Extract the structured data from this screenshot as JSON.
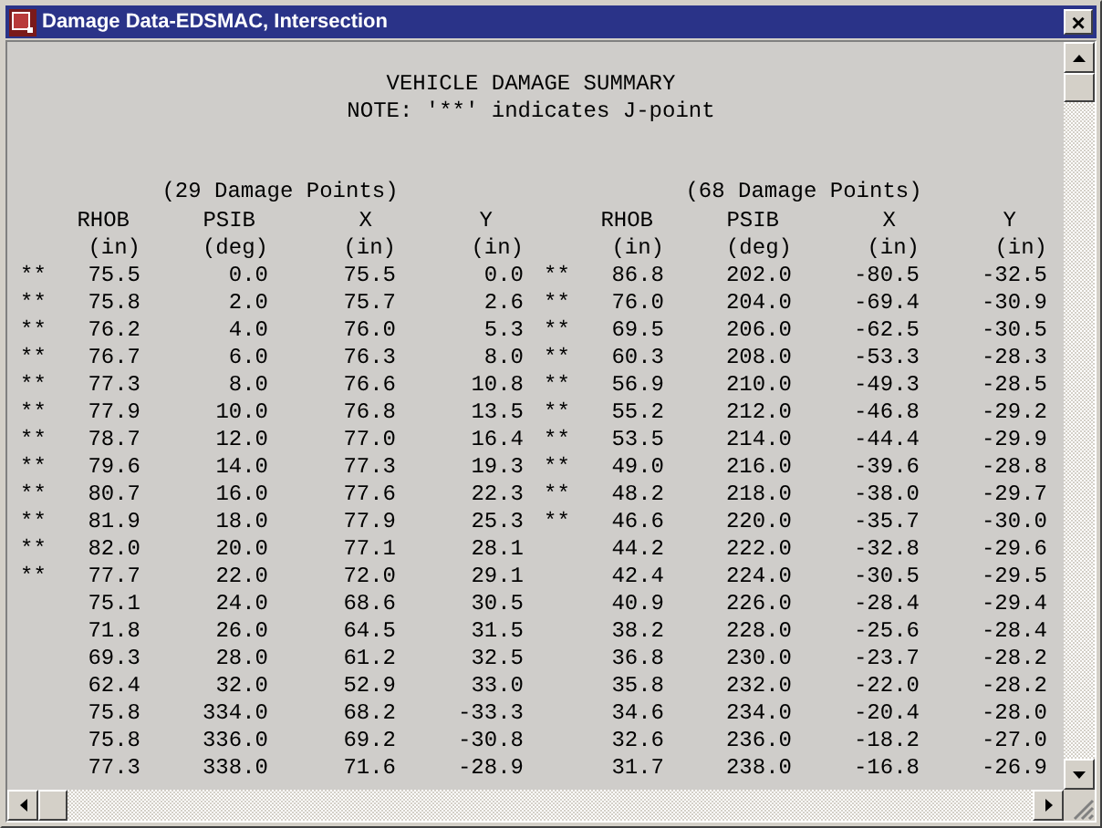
{
  "window": {
    "title": "Damage Data-EDSMAC, Intersection",
    "close_label": "×"
  },
  "heading": "VEHICLE DAMAGE SUMMARY",
  "note": "NOTE: '**' indicates J-point",
  "groups": [
    {
      "title": "(29 Damage Points)",
      "marker": "**",
      "columns": [
        {
          "name": "RHOB",
          "unit": "(in)"
        },
        {
          "name": "PSIB",
          "unit": "(deg)"
        },
        {
          "name": "X",
          "unit": "(in)"
        },
        {
          "name": "Y",
          "unit": "(in)"
        }
      ],
      "rows": [
        {
          "jpoint": true,
          "values": [
            "75.5",
            "0.0",
            "75.5",
            "0.0"
          ]
        },
        {
          "jpoint": true,
          "values": [
            "75.8",
            "2.0",
            "75.7",
            "2.6"
          ]
        },
        {
          "jpoint": true,
          "values": [
            "76.2",
            "4.0",
            "76.0",
            "5.3"
          ]
        },
        {
          "jpoint": true,
          "values": [
            "76.7",
            "6.0",
            "76.3",
            "8.0"
          ]
        },
        {
          "jpoint": true,
          "values": [
            "77.3",
            "8.0",
            "76.6",
            "10.8"
          ]
        },
        {
          "jpoint": true,
          "values": [
            "77.9",
            "10.0",
            "76.8",
            "13.5"
          ]
        },
        {
          "jpoint": true,
          "values": [
            "78.7",
            "12.0",
            "77.0",
            "16.4"
          ]
        },
        {
          "jpoint": true,
          "values": [
            "79.6",
            "14.0",
            "77.3",
            "19.3"
          ]
        },
        {
          "jpoint": true,
          "values": [
            "80.7",
            "16.0",
            "77.6",
            "22.3"
          ]
        },
        {
          "jpoint": true,
          "values": [
            "81.9",
            "18.0",
            "77.9",
            "25.3"
          ]
        },
        {
          "jpoint": true,
          "values": [
            "82.0",
            "20.0",
            "77.1",
            "28.1"
          ]
        },
        {
          "jpoint": true,
          "values": [
            "77.7",
            "22.0",
            "72.0",
            "29.1"
          ]
        },
        {
          "jpoint": false,
          "values": [
            "75.1",
            "24.0",
            "68.6",
            "30.5"
          ]
        },
        {
          "jpoint": false,
          "values": [
            "71.8",
            "26.0",
            "64.5",
            "31.5"
          ]
        },
        {
          "jpoint": false,
          "values": [
            "69.3",
            "28.0",
            "61.2",
            "32.5"
          ]
        },
        {
          "jpoint": false,
          "values": [
            "62.4",
            "32.0",
            "52.9",
            "33.0"
          ]
        },
        {
          "jpoint": false,
          "values": [
            "75.8",
            "334.0",
            "68.2",
            "-33.3"
          ]
        },
        {
          "jpoint": false,
          "values": [
            "75.8",
            "336.0",
            "69.2",
            "-30.8"
          ]
        },
        {
          "jpoint": false,
          "values": [
            "77.3",
            "338.0",
            "71.6",
            "-28.9"
          ]
        }
      ]
    },
    {
      "title": "(68 Damage Points)",
      "marker": "**",
      "columns": [
        {
          "name": "RHOB",
          "unit": "(in)"
        },
        {
          "name": "PSIB",
          "unit": "(deg)"
        },
        {
          "name": "X",
          "unit": "(in)"
        },
        {
          "name": "Y",
          "unit": "(in)"
        }
      ],
      "rows": [
        {
          "jpoint": true,
          "values": [
            "86.8",
            "202.0",
            "-80.5",
            "-32.5"
          ]
        },
        {
          "jpoint": true,
          "values": [
            "76.0",
            "204.0",
            "-69.4",
            "-30.9"
          ]
        },
        {
          "jpoint": true,
          "values": [
            "69.5",
            "206.0",
            "-62.5",
            "-30.5"
          ]
        },
        {
          "jpoint": true,
          "values": [
            "60.3",
            "208.0",
            "-53.3",
            "-28.3"
          ]
        },
        {
          "jpoint": true,
          "values": [
            "56.9",
            "210.0",
            "-49.3",
            "-28.5"
          ]
        },
        {
          "jpoint": true,
          "values": [
            "55.2",
            "212.0",
            "-46.8",
            "-29.2"
          ]
        },
        {
          "jpoint": true,
          "values": [
            "53.5",
            "214.0",
            "-44.4",
            "-29.9"
          ]
        },
        {
          "jpoint": true,
          "values": [
            "49.0",
            "216.0",
            "-39.6",
            "-28.8"
          ]
        },
        {
          "jpoint": true,
          "values": [
            "48.2",
            "218.0",
            "-38.0",
            "-29.7"
          ]
        },
        {
          "jpoint": true,
          "values": [
            "46.6",
            "220.0",
            "-35.7",
            "-30.0"
          ]
        },
        {
          "jpoint": false,
          "values": [
            "44.2",
            "222.0",
            "-32.8",
            "-29.6"
          ]
        },
        {
          "jpoint": false,
          "values": [
            "42.4",
            "224.0",
            "-30.5",
            "-29.5"
          ]
        },
        {
          "jpoint": false,
          "values": [
            "40.9",
            "226.0",
            "-28.4",
            "-29.4"
          ]
        },
        {
          "jpoint": false,
          "values": [
            "38.2",
            "228.0",
            "-25.6",
            "-28.4"
          ]
        },
        {
          "jpoint": false,
          "values": [
            "36.8",
            "230.0",
            "-23.7",
            "-28.2"
          ]
        },
        {
          "jpoint": false,
          "values": [
            "35.8",
            "232.0",
            "-22.0",
            "-28.2"
          ]
        },
        {
          "jpoint": false,
          "values": [
            "34.6",
            "234.0",
            "-20.4",
            "-28.0"
          ]
        },
        {
          "jpoint": false,
          "values": [
            "32.6",
            "236.0",
            "-18.2",
            "-27.0"
          ]
        },
        {
          "jpoint": false,
          "values": [
            "31.7",
            "238.0",
            "-16.8",
            "-26.9"
          ]
        }
      ]
    }
  ]
}
